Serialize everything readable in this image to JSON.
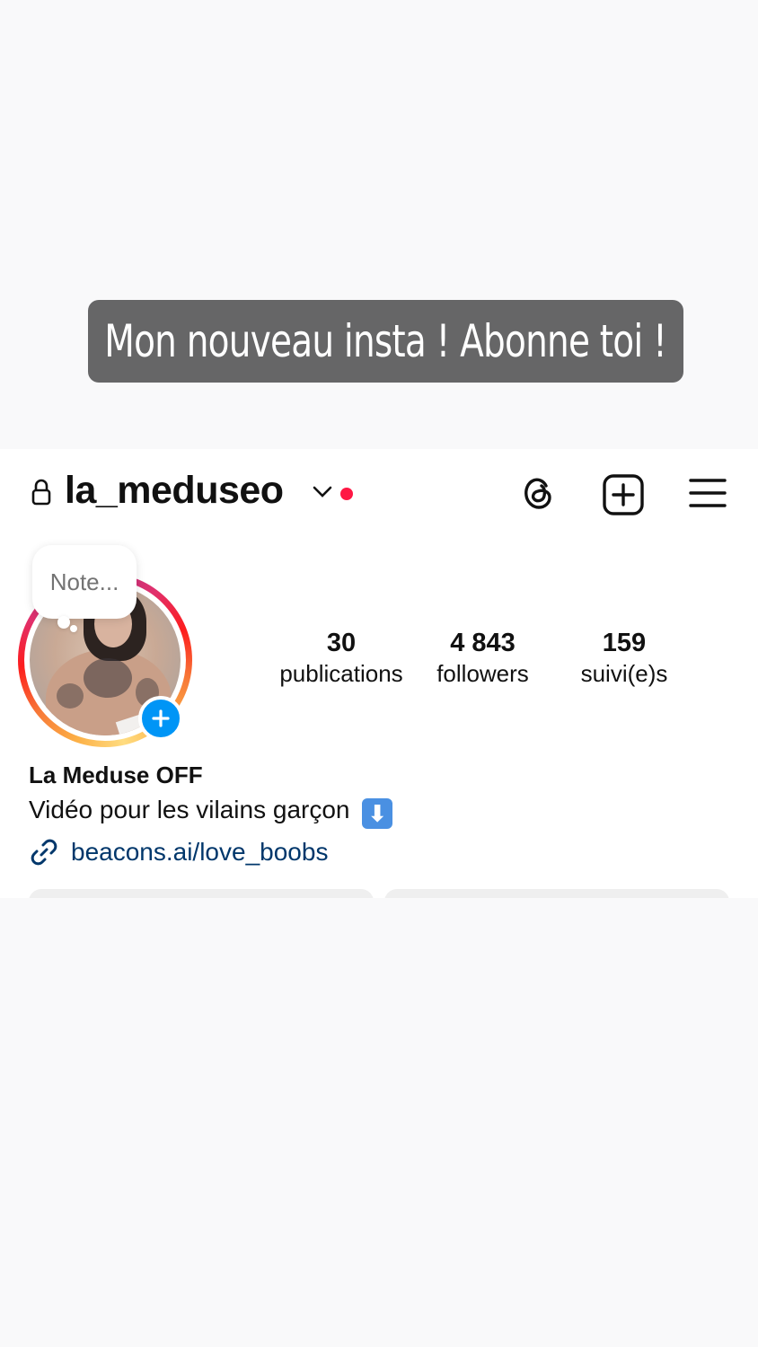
{
  "story": {
    "caption": "Mon nouveau insta ! Abonne toi !"
  },
  "header": {
    "username": "la_meduseo",
    "icons": [
      "lock-icon",
      "chevron-down-icon",
      "threads-icon",
      "add-post-icon",
      "menu-icon"
    ],
    "notification_dot_color": "#ff1744"
  },
  "note": {
    "placeholder": "Note..."
  },
  "stats": {
    "posts": {
      "count": "30",
      "label": "publications"
    },
    "followers": {
      "count": "4 843",
      "label": "followers"
    },
    "following": {
      "count": "159",
      "label": "suivi(e)s"
    }
  },
  "profile": {
    "display_name": "La Meduse OFF",
    "bio": "Vidéo pour les vilains garçon",
    "bio_emoji": "⬇",
    "link": "beacons.ai/love_boobs"
  },
  "colors": {
    "accent": "#0095f6",
    "link": "#00376b",
    "caption_bg": "#666667"
  }
}
